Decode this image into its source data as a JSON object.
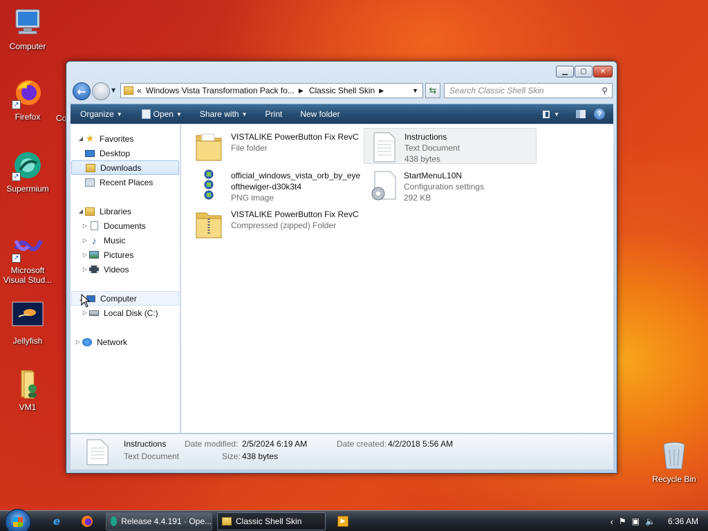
{
  "desktop": {
    "icons": [
      {
        "label": "Computer",
        "icon": "computer-icon"
      },
      {
        "label": "Firefox",
        "icon": "firefox-icon"
      },
      {
        "label": "Supermium",
        "icon": "supermium-icon"
      },
      {
        "label": "Microsoft Visual Stud...",
        "icon": "visual-studio-icon"
      },
      {
        "label": "Jellyfish",
        "icon": "jellyfish-icon"
      },
      {
        "label": "VM1",
        "icon": "folder-user-icon"
      },
      {
        "label": "Recycle Bin",
        "icon": "recycle-bin-icon"
      }
    ],
    "partial_label": "Co"
  },
  "window": {
    "address": {
      "overflow": "«",
      "segments": [
        "Windows Vista Transformation Pack fo...",
        "Classic Shell Skin"
      ]
    },
    "search_placeholder": "Search Classic Shell Skin",
    "commands": {
      "organize": "Organize",
      "open": "Open",
      "share_with": "Share with",
      "print": "Print",
      "new_folder": "New folder"
    },
    "nav": {
      "favorites": "Favorites",
      "desktop": "Desktop",
      "downloads": "Downloads",
      "recent_places": "Recent Places",
      "libraries": "Libraries",
      "documents": "Documents",
      "music": "Music",
      "pictures": "Pictures",
      "videos": "Videos",
      "computer": "Computer",
      "local_disk": "Local Disk (C:)",
      "network": "Network"
    },
    "files": [
      {
        "name": "VISTALIKE PowerButton Fix RevC",
        "line2": "File folder",
        "line3": "",
        "type": "folder"
      },
      {
        "name": "Instructions",
        "line2": "Text Document",
        "line3": "438 bytes",
        "type": "text"
      },
      {
        "name": "official_windows_vista_orb_by_eye",
        "line2": "ofthewiger-d30k3t4",
        "line3": "PNG image",
        "type": "png"
      },
      {
        "name": "StartMenuL10N",
        "line2": "Configuration settings",
        "line3": "292 KB",
        "type": "ini"
      },
      {
        "name": "VISTALIKE PowerButton Fix RevC",
        "line2": "Compressed (zipped) Folder",
        "line3": "",
        "type": "zip"
      }
    ],
    "details": {
      "name": "Instructions",
      "type": "Text Document",
      "date_modified_label": "Date modified:",
      "date_modified": "2/5/2024 6:19 AM",
      "date_created_label": "Date created:",
      "date_created": "4/2/2018 5:56 AM",
      "size_label": "Size:",
      "size": "438 bytes"
    }
  },
  "taskbar": {
    "tasks": [
      {
        "label": "Release 4.4.191 · Ope...",
        "icon": "supermium-icon"
      },
      {
        "label": "Classic Shell Skin",
        "icon": "folder-icon"
      }
    ],
    "clock": "6:36 AM"
  },
  "colors": {
    "command_bar": "#274d72",
    "selection": "#d6e7f9",
    "taskbar": "#262c35"
  }
}
